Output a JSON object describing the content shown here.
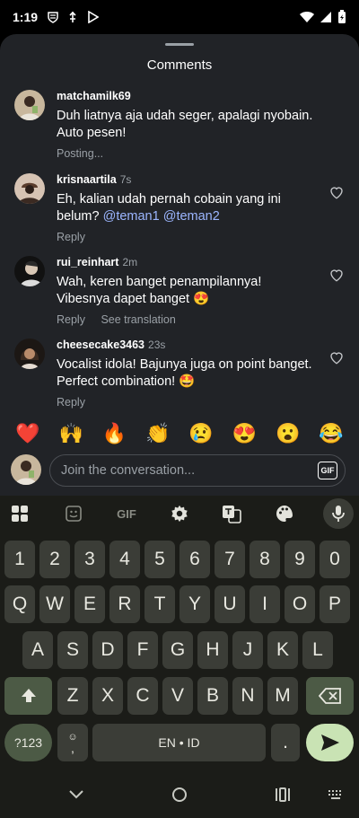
{
  "status_bar": {
    "time": "1:19"
  },
  "sheet": {
    "title": "Comments",
    "comments": [
      {
        "username": "matchamilk69",
        "time": "",
        "text": "Duh liatnya aja udah seger, apalagi nyobain. Auto pesen!",
        "status": "Posting...",
        "liked": false
      },
      {
        "username": "krisnaartila",
        "time": "7s",
        "text": "Eh, kalian udah pernah cobain yang ini belum?",
        "mentions": [
          "@teman1",
          "@teman2"
        ],
        "reply_label": "Reply"
      },
      {
        "username": "rui_reinhart",
        "time": "2m",
        "text": "Wah, keren banget penampilannya! Vibesnya dapet banget 😍",
        "reply_label": "Reply",
        "translate_label": "See translation"
      },
      {
        "username": "cheesecake3463",
        "time": "23s",
        "text": "Vocalist idola! Bajunya juga on point banget. Perfect combination! 🤩",
        "reply_label": "Reply"
      }
    ],
    "emoji_bar": [
      "❤️",
      "🙌",
      "🔥",
      "👏",
      "😢",
      "😍",
      "😮",
      "😂"
    ],
    "composer": {
      "placeholder": "Join the conversation...",
      "gif_label": "GIF"
    }
  },
  "keyboard": {
    "toolbar": {
      "gif_label": "GIF"
    },
    "rows": [
      [
        "1",
        "2",
        "3",
        "4",
        "5",
        "6",
        "7",
        "8",
        "9",
        "0"
      ],
      [
        "Q",
        "W",
        "E",
        "R",
        "T",
        "Y",
        "U",
        "I",
        "O",
        "P"
      ],
      [
        "A",
        "S",
        "D",
        "F",
        "G",
        "H",
        "J",
        "K",
        "L"
      ],
      [
        "Z",
        "X",
        "C",
        "V",
        "B",
        "N",
        "M"
      ]
    ],
    "symbols_label": "?123",
    "comma_label": ",",
    "space_label": "EN • ID",
    "period_label": "."
  },
  "colors": {
    "sheet_bg": "#212327",
    "keyboard_bg": "#1b1c18",
    "key_bg": "#3b3d37",
    "enter_bg": "#c9e3b4",
    "mention": "#9cb6ff"
  }
}
